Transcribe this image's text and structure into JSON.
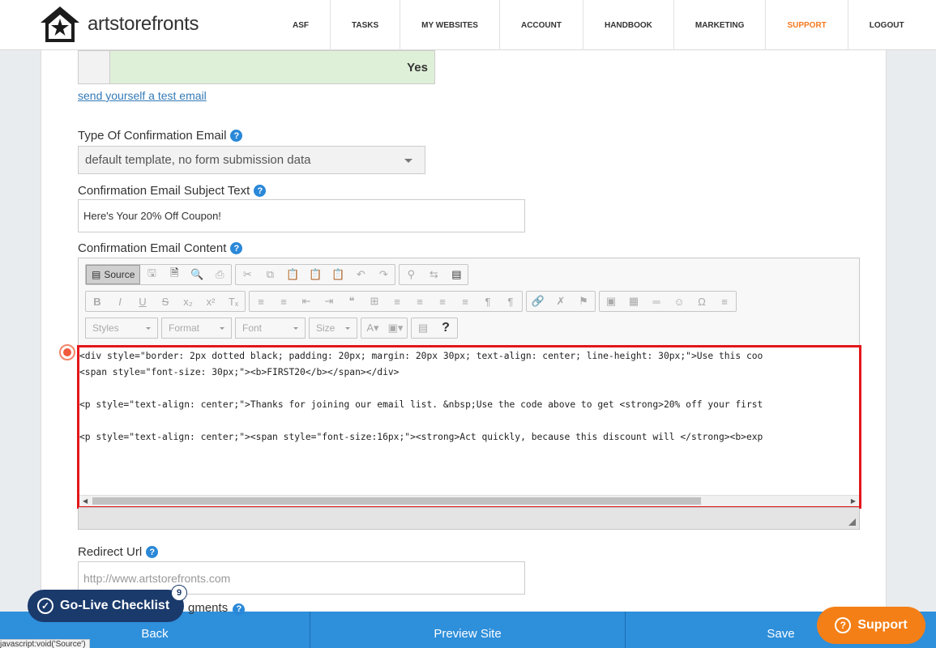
{
  "header": {
    "logo_text_bold": "art",
    "logo_text_rest": "storefronts",
    "nav": [
      {
        "label": "ASF"
      },
      {
        "label": "TASKS"
      },
      {
        "label": "MY WEBSITES"
      },
      {
        "label": "ACCOUNT"
      },
      {
        "label": "HANDBOOK"
      },
      {
        "label": "MARKETING"
      },
      {
        "label": "SUPPORT",
        "active": true
      },
      {
        "label": "LOGOUT"
      }
    ]
  },
  "form": {
    "toggle_value": "Yes",
    "test_email_link": "send yourself a test email",
    "confirmation_type": {
      "label": "Type Of Confirmation Email",
      "selected": "default template, no form submission data"
    },
    "subject": {
      "label": "Confirmation Email Subject Text",
      "value": "Here's Your 20% Off Coupon!"
    },
    "content": {
      "label": "Confirmation Email Content",
      "source_button": "Source",
      "combos": {
        "styles": "Styles",
        "format": "Format",
        "font": "Font",
        "size": "Size"
      },
      "code_lines": [
        "<div style=\"border: 2px dotted black; padding: 20px; margin: 20px 30px; text-align: center; line-height: 30px;\">Use this coo",
        "<span style=\"font-size: 30px;\"><b>FIRST20</b></span></div>",
        "<p style=\"text-align: center;\">Thanks for joining our email list. &nbsp;Use the code above to get <strong>20% off your first",
        "<p style=\"text-align: center;\"><span style=\"font-size:16px;\"><strong>Act quickly, because this discount will </strong><b>exp"
      ]
    },
    "redirect": {
      "label": "Redirect Url",
      "placeholder": "http://www.artstorefronts.com"
    },
    "next_label_peek": "gments"
  },
  "bottom": {
    "back": "Back",
    "preview": "Preview Site",
    "save": "Save"
  },
  "golive": {
    "label": "Go-Live Checklist",
    "count": "9"
  },
  "support_button": "Support",
  "status_url": "javascript:void('Source')",
  "colors": {
    "accent_orange": "#f47a20",
    "bottom_bar": "#2e8fdb",
    "highlight_red": "#e3161b",
    "yes_green": "#dff0d8",
    "golive_navy": "#1a3a6c"
  }
}
